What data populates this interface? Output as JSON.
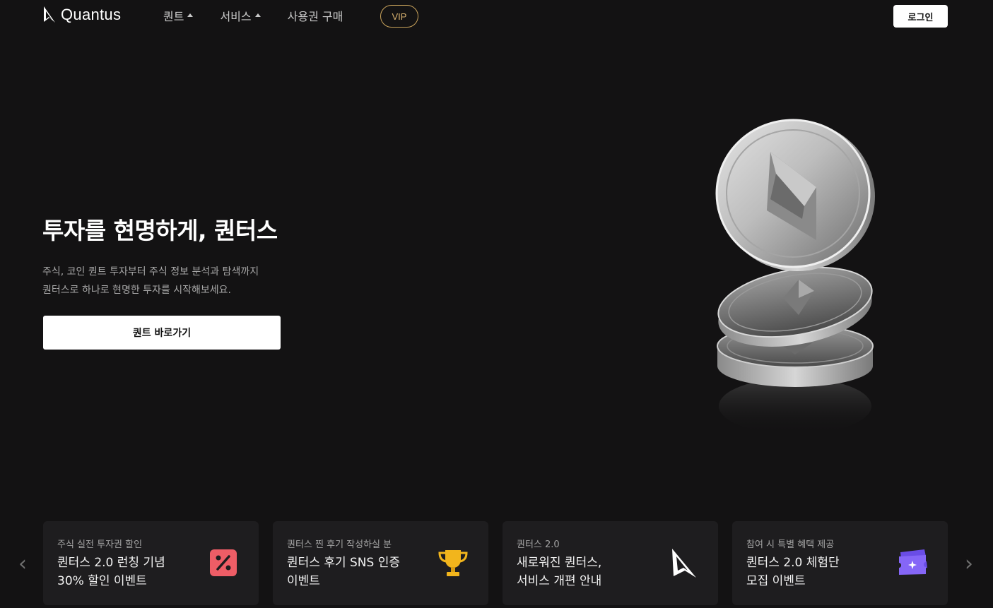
{
  "header": {
    "logo_text": "Quantus",
    "nav": [
      {
        "label": "퀀트",
        "has_caret": true
      },
      {
        "label": "서비스",
        "has_caret": true
      },
      {
        "label": "사용권 구매",
        "has_caret": false
      }
    ],
    "vip_label": "VIP",
    "login_label": "로그인"
  },
  "hero": {
    "title": "투자를 현명하게, 퀀터스",
    "desc_line1": "주식, 코인 퀀트 투자부터 주식 정보 분석과 탐색까지",
    "desc_line2": "퀀터스로 하나로 현명한 투자를 시작해보세요.",
    "cta_label": "퀀트 바로가기"
  },
  "cards": [
    {
      "tag": "주식 실전 투자권 할인",
      "line1": "퀀터스 2.0 런칭 기념",
      "line2": "30% 할인 이벤트",
      "icon": "percent-tag-icon"
    },
    {
      "tag": "퀀터스 찐 후기 작성하실 분",
      "line1": "퀀터스 후기 SNS 인증",
      "line2": "이벤트",
      "icon": "trophy-icon"
    },
    {
      "tag": "퀀터스 2.0",
      "line1": "새로워진 퀀터스,",
      "line2": "서비스 개편 안내",
      "icon": "quantus-logo-icon"
    },
    {
      "tag": "참여 시 특별 혜택 제공",
      "line1": "퀀터스 2.0 체험단",
      "line2": "모집 이벤트",
      "icon": "ticket-icon"
    }
  ],
  "colors": {
    "background": "#131213",
    "card": "#1e1d1f",
    "vip_accent": "#c9a35b",
    "percent_icon": "#ee5d66",
    "trophy_icon": "#f2b51c",
    "ticket_icon": "#7b5cf5"
  }
}
